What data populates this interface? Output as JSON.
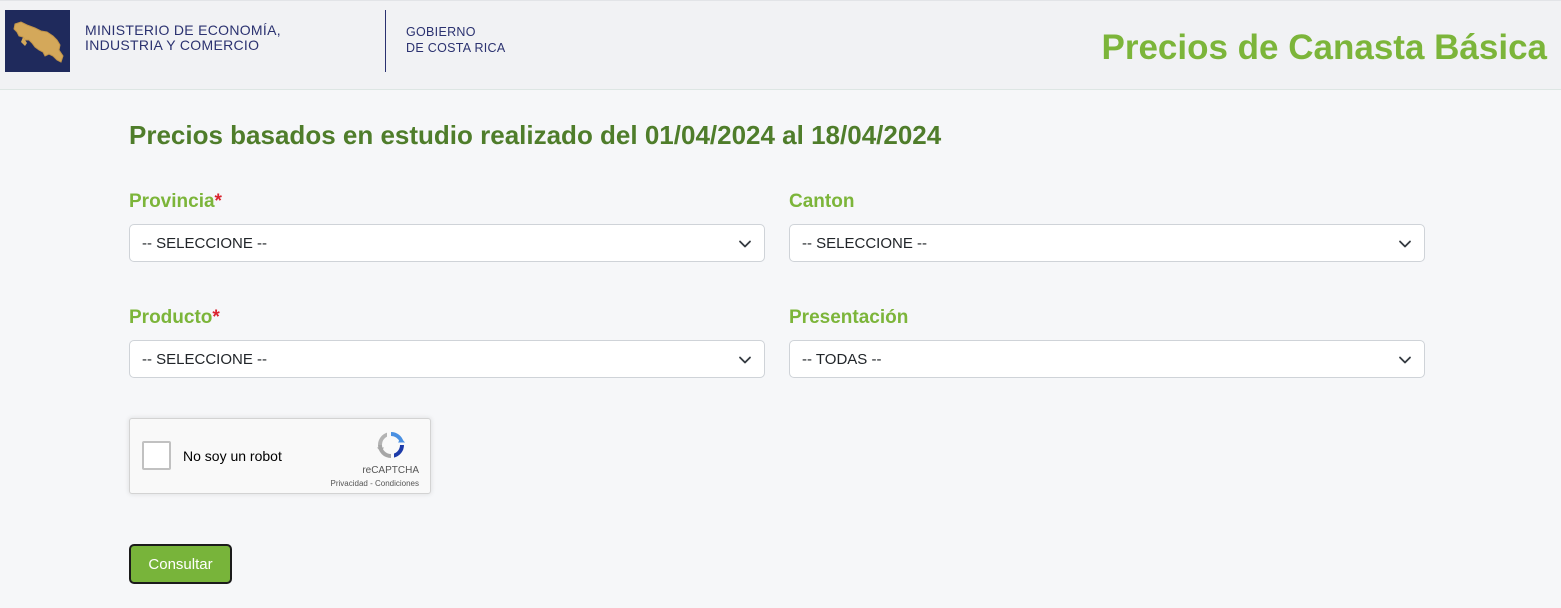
{
  "header": {
    "logo_icon": "costa-rica-map-icon",
    "ministry_line1": "MINISTERIO DE ECONOMÍA,",
    "ministry_line2": "INDUSTRIA Y COMERCIO",
    "gov_line1": "GOBIERNO",
    "gov_line2": "DE COSTA RICA",
    "title": "Precios de Canasta Básica"
  },
  "main": {
    "heading": "Precios basados en estudio realizado del 01/04/2024 al 18/04/2024",
    "fields": {
      "provincia": {
        "label": "Provincia",
        "required": "*",
        "value": "-- SELECCIONE --"
      },
      "canton": {
        "label": "Canton",
        "value": "-- SELECCIONE --"
      },
      "producto": {
        "label": "Producto",
        "required": "*",
        "value": "-- SELECCIONE --"
      },
      "presentacion": {
        "label": "Presentación",
        "value": "-- TODAS --"
      }
    },
    "captcha": {
      "label": "No soy un robot",
      "brand": "reCAPTCHA",
      "links": "Privacidad - Condiciones"
    },
    "submit_label": "Consultar"
  },
  "colors": {
    "accent_green": "#7cb53a",
    "heading_green": "#4f7d2b",
    "navy": "#2b3270",
    "required_red": "#d9232e"
  }
}
